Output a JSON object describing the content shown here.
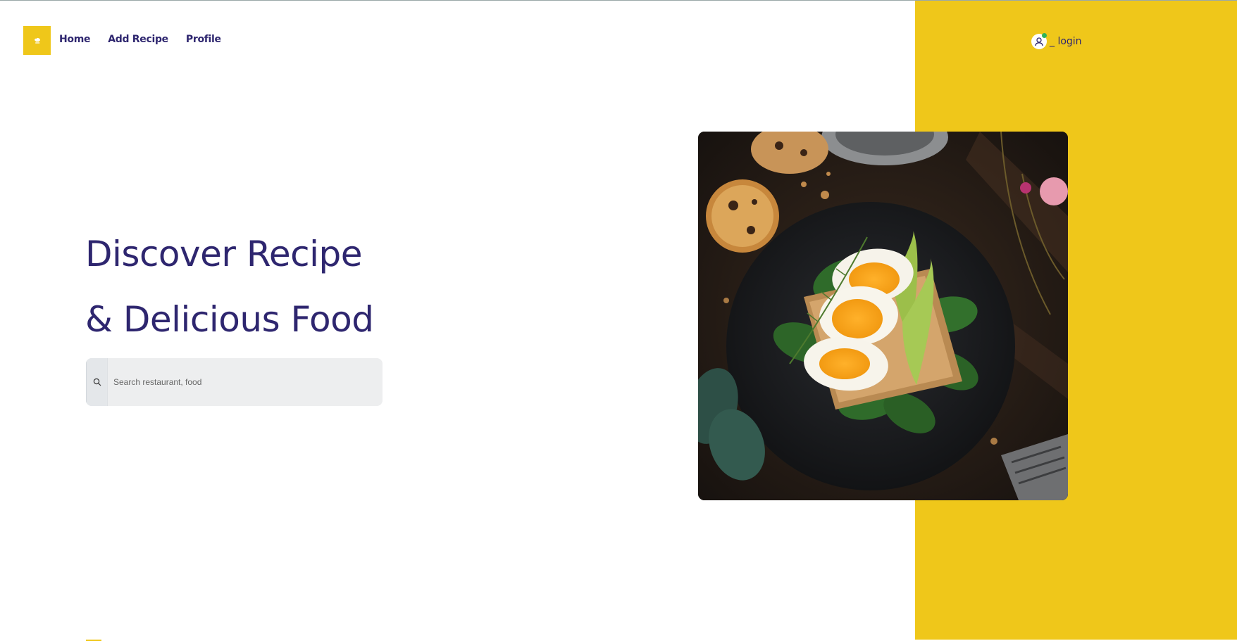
{
  "nav": {
    "items": [
      {
        "label": "Home"
      },
      {
        "label": "Add Recipe"
      },
      {
        "label": "Profile"
      }
    ],
    "login_label": "login",
    "logo_icon": "chef-hat-icon",
    "avatar_icon": "user-icon"
  },
  "hero": {
    "line1": "Discover Recipe",
    "line2": "& Delicious Food"
  },
  "search": {
    "placeholder": "Search restaurant, food",
    "icon": "search-icon"
  },
  "colors": {
    "accent": "#efc71a",
    "primary_text": "#2e266f",
    "status_dot": "#2fb35a"
  }
}
